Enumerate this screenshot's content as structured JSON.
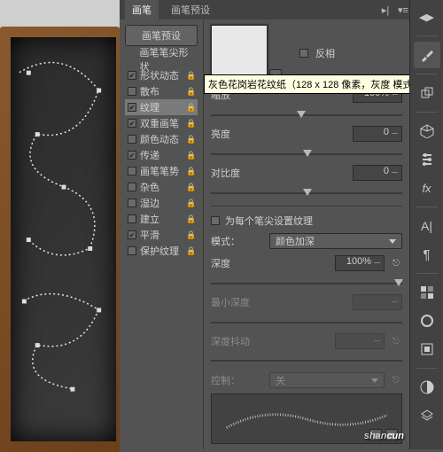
{
  "tabs": {
    "t1": "画笔",
    "t2": "画笔预设"
  },
  "preset_button": "画笔预设",
  "list": [
    {
      "label": "画笔笔尖形状",
      "cb": null,
      "lock": false
    },
    {
      "label": "形状动态",
      "cb": true,
      "lock": true
    },
    {
      "label": "散布",
      "cb": false,
      "lock": true
    },
    {
      "label": "纹理",
      "cb": true,
      "lock": true,
      "active": true
    },
    {
      "label": "双重画笔",
      "cb": true,
      "lock": true
    },
    {
      "label": "颜色动态",
      "cb": false,
      "lock": true
    },
    {
      "label": "传递",
      "cb": true,
      "lock": true
    },
    {
      "label": "画笔笔势",
      "cb": false,
      "lock": true
    },
    {
      "label": "杂色",
      "cb": false,
      "lock": true
    },
    {
      "label": "湿边",
      "cb": false,
      "lock": true
    },
    {
      "label": "建立",
      "cb": false,
      "lock": true
    },
    {
      "label": "平滑",
      "cb": true,
      "lock": true
    },
    {
      "label": "保护纹理",
      "cb": false,
      "lock": true
    }
  ],
  "invert": {
    "label": "反相",
    "checked": false
  },
  "tooltip": "灰色花岗岩花纹纸（128 x 128 像素，灰度 模式）",
  "scale": {
    "label": "缩放",
    "value": "100%"
  },
  "brightness": {
    "label": "亮度",
    "value": "0"
  },
  "contrast": {
    "label": "对比度",
    "value": "0"
  },
  "each_tip": {
    "label": "为每个笔尖设置纹理",
    "checked": false
  },
  "mode": {
    "label": "模式：",
    "value": "颜色加深"
  },
  "depth": {
    "label": "深度",
    "value": "100%"
  },
  "min_depth": {
    "label": "最小深度",
    "value": ""
  },
  "depth_jitter": {
    "label": "深度抖动",
    "value": ""
  },
  "control": {
    "label": "控制：",
    "value": "关"
  },
  "watermark": {
    "a": "shan",
    "b": "cun"
  }
}
